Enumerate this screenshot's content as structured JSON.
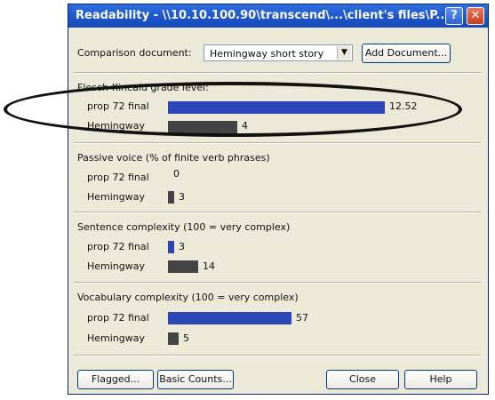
{
  "window": {
    "title": "Readability - \\\\10.10.100.90\\transcend\\...\\client's files\\P..."
  },
  "title_buttons": {
    "help": "?",
    "close": "✕"
  },
  "comparison": {
    "label": "Comparison document:",
    "selected": "Hemingway short story",
    "add_button": "Add Document..."
  },
  "sections": [
    {
      "title": "Flesch-Kincaid grade level:",
      "rows": [
        {
          "label": "prop 72 final",
          "value": 12.52,
          "display": "12.52",
          "fraction": 1.0,
          "color": "#2a46b8"
        },
        {
          "label": "Hemingway",
          "value": 4,
          "display": "4",
          "fraction": 0.32,
          "color": "#444444"
        }
      ]
    },
    {
      "title": "Passive voice (% of finite verb phrases)",
      "rows": [
        {
          "label": "prop 72 final",
          "value": 0,
          "display": "0",
          "fraction": 0,
          "color": "#2a46b8"
        },
        {
          "label": "Hemingway",
          "value": 3,
          "display": "3",
          "fraction": 0.03,
          "color": "#444444"
        }
      ]
    },
    {
      "title": "Sentence complexity (100 = very complex)",
      "rows": [
        {
          "label": "prop 72 final",
          "value": 3,
          "display": "3",
          "fraction": 0.03,
          "color": "#2a46b8"
        },
        {
          "label": "Hemingway",
          "value": 14,
          "display": "14",
          "fraction": 0.14,
          "color": "#444444"
        }
      ]
    },
    {
      "title": "Vocabulary complexity (100 = very complex)",
      "rows": [
        {
          "label": "prop 72 final",
          "value": 57,
          "display": "57",
          "fraction": 0.57,
          "color": "#2a46b8"
        },
        {
          "label": "Hemingway",
          "value": 5,
          "display": "5",
          "fraction": 0.05,
          "color": "#444444"
        }
      ]
    }
  ],
  "footer": {
    "flagged": "Flagged...",
    "basic_counts": "Basic Counts...",
    "close": "Close",
    "help": "Help"
  }
}
